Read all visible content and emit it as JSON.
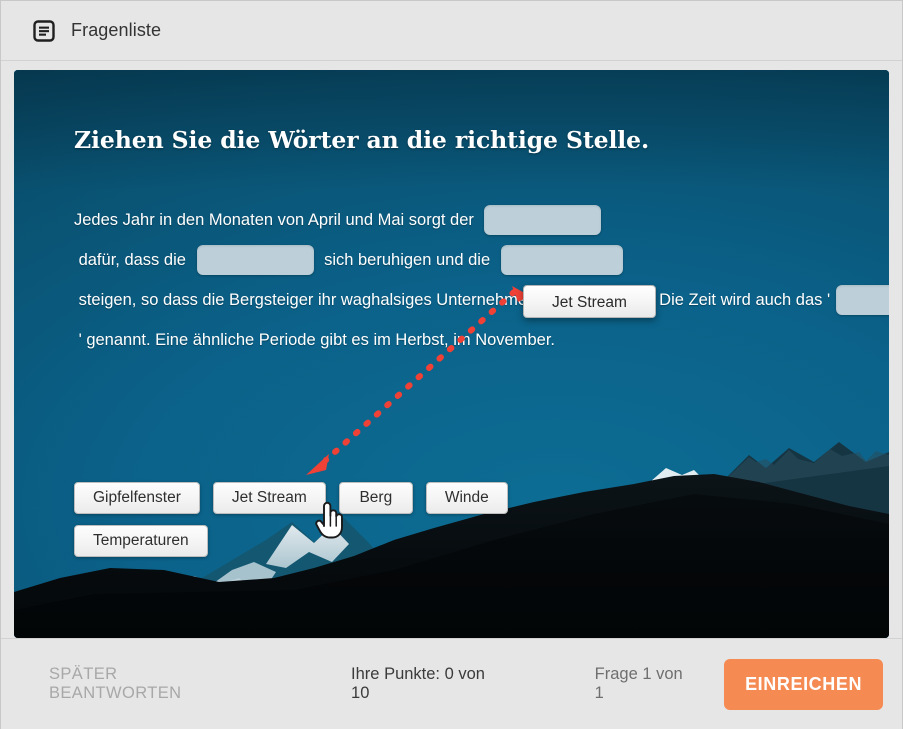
{
  "header": {
    "icon": "question-list-icon",
    "title": "Fragenliste"
  },
  "question": {
    "title": "Ziehen Sie die Wörter an die richtige Stelle.",
    "segments": [
      "Jedes Jahr in den Monaten von April und Mai sorgt der ",
      " dafür, dass die ",
      " sich beruhigen und die ",
      " steigen, so dass die Bergsteiger ihr waghalsiges Unternehmen starten können. Die Zeit wird auch das '",
      " ' genannt. Eine ähnliche Periode gibt es im Herbst, im November."
    ],
    "slot_placeholder": ""
  },
  "drag": {
    "floating_chip_label": "Jet Stream",
    "arrow_color": "#ef4136",
    "cursor": "pointing-hand-cursor"
  },
  "answers": {
    "row1": [
      "Gipfelfenster",
      "Jet Stream",
      "Berg",
      "Winde"
    ],
    "row2": [
      "Temperaturen"
    ]
  },
  "footer": {
    "answer_later_label": "SPÄTER BEANTWORTEN",
    "points_label": "Ihre Punkte: 0 von 10",
    "progress_label": "Frage 1 von 1",
    "submit_label": "EINREICHEN",
    "submit_color": "#f58a52"
  }
}
